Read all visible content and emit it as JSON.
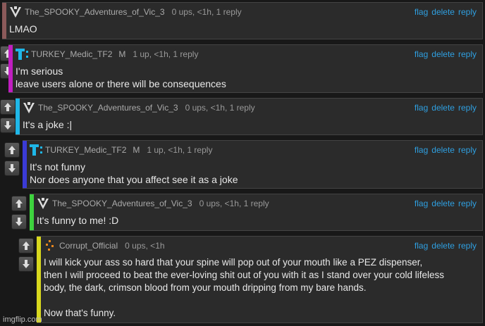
{
  "actions": {
    "flag": "flag",
    "delete": "delete",
    "reply": "reply"
  },
  "comments": [
    {
      "username": "The_SPOOKY_Adventures_of_Vic_3",
      "mod_badge": "",
      "meta": "0 ups, <1h, 1 reply",
      "text": "LMAO",
      "bar_color": "#8b5a5a",
      "avatar": "vic-avatar-icon"
    },
    {
      "username": "TURKEY_Medic_TF2",
      "mod_badge": "M",
      "meta": "1 up, <1h, 1 reply",
      "text": "I'm serious\nleave users alone or there will be consequences",
      "bar_color": "#c01ec0",
      "avatar": "turkey-avatar-icon"
    },
    {
      "username": "The_SPOOKY_Adventures_of_Vic_3",
      "mod_badge": "",
      "meta": "0 ups, <1h, 1 reply",
      "text": "It's a joke :|",
      "bar_color": "#1fb7e8",
      "avatar": "vic-avatar-icon"
    },
    {
      "username": "TURKEY_Medic_TF2",
      "mod_badge": "M",
      "meta": "1 up, <1h, 1 reply",
      "text": "It's not funny\nNor does anyone that you affect see it as a joke",
      "bar_color": "#3b3bd6",
      "avatar": "turkey-avatar-icon"
    },
    {
      "username": "The_SPOOKY_Adventures_of_Vic_3",
      "mod_badge": "",
      "meta": "0 ups, <1h, 1 reply",
      "text": "It's funny to me! :D",
      "bar_color": "#3ed33e",
      "avatar": "vic-avatar-icon"
    },
    {
      "username": "Corrupt_Official",
      "mod_badge": "",
      "meta": "0 ups, <1h",
      "text": "I will kick your ass so hard that your spine will pop out of your mouth like a PEZ dispenser,\nthen I will proceed to beat the ever-loving shit out of you with it as I stand over your cold lifeless\nbody, the dark, crimson blood from your mouth dripping from my bare hands.\n\nNow that's funny.",
      "bar_color": "#d8d81e",
      "avatar": "corrupt-avatar-icon"
    }
  ],
  "watermark": "imgflip.com"
}
